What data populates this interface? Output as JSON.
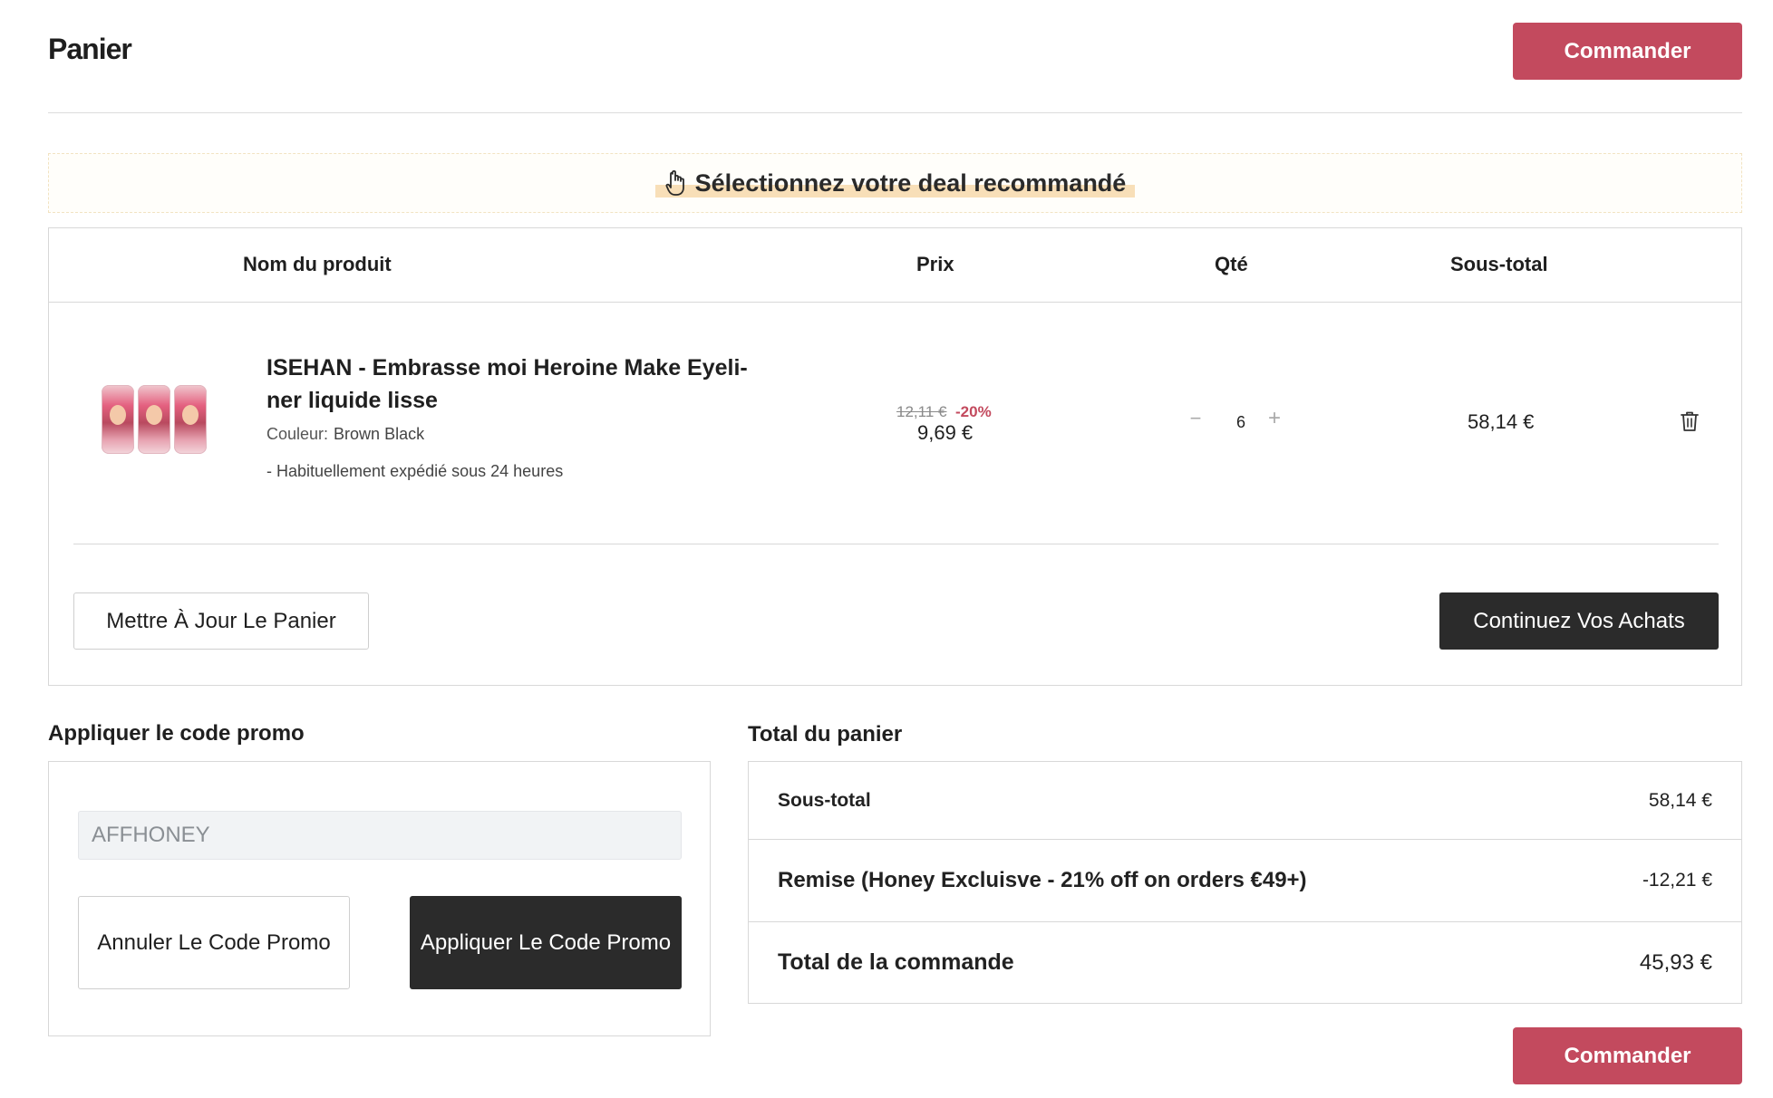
{
  "header": {
    "title": "Panier",
    "checkout_label": "Commander"
  },
  "deal_banner": {
    "icon": "pointing-hand-icon",
    "text": "Sélectionnez votre deal recommandé"
  },
  "cart_table": {
    "columns": [
      "Nom du produit",
      "Prix",
      "Qté",
      "Sous-total"
    ],
    "rows": [
      {
        "image": "eyeliner-product-image",
        "name": "ISEHAN - Embrasse moi Heroine Make Eyeli-ner liquide lisse",
        "color_label": "Couleur:",
        "color_value": "Brown Black",
        "shipping": "- Habituellement expédié sous 24 heures",
        "old_price": "12,11 €",
        "discount": "-20%",
        "price": "9,69 €",
        "quantity": "6",
        "subtotal": "58,14 €"
      }
    ],
    "update_label": "Mettre À Jour Le Panier",
    "continue_label": "Continuez Vos Achats"
  },
  "promo": {
    "title": "Appliquer le code promo",
    "code_value": "AFFHONEY",
    "cancel_label": "Annuler Le Code Promo",
    "apply_label": "Appliquer Le Code Promo"
  },
  "totals": {
    "title": "Total du panier",
    "subtotal_label": "Sous-total",
    "subtotal_value": "58,14 €",
    "discount_label": "Remise (Honey Excluisve - 21% off on orders €49+)",
    "discount_value": "-12,21 €",
    "total_label": "Total de la commande",
    "total_value": "45,93 €",
    "checkout_label": "Commander"
  },
  "colors": {
    "accent": "#c34a5e",
    "dark_button": "#2b2b2b",
    "deal_highlight": "#f8dfb8"
  }
}
